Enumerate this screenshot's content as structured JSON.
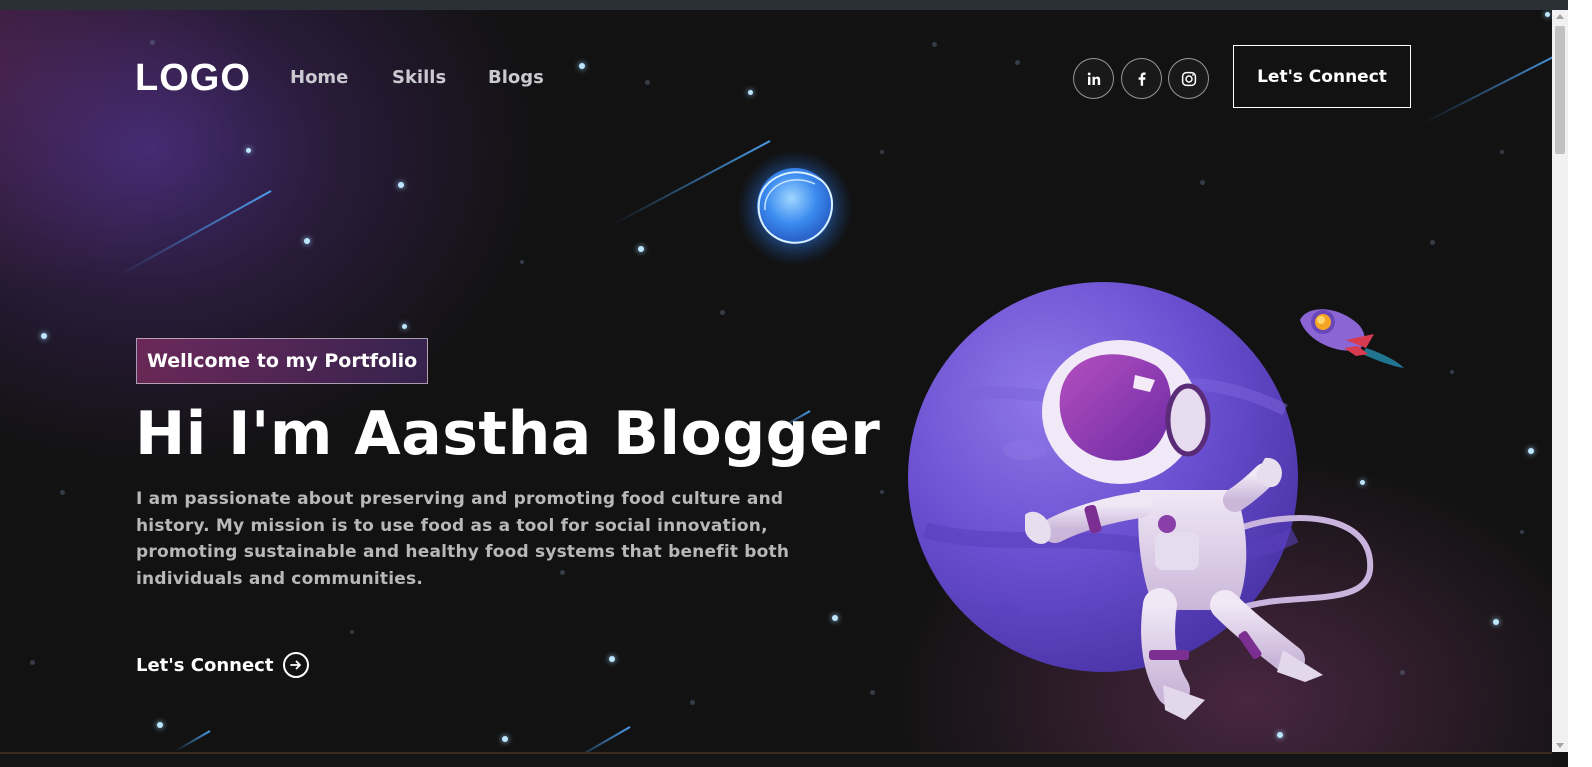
{
  "nav": {
    "logo": "LOGO",
    "links": [
      "Home",
      "Skills",
      "Blogs"
    ],
    "social": [
      "linkedin-icon",
      "facebook-icon",
      "instagram-icon"
    ],
    "connect_button": "Let's Connect"
  },
  "hero": {
    "tagline": "Wellcome to my Portfolio",
    "title": "Hi I'm Aastha Blogger",
    "description": "I am passionate about preserving and promoting food culture and history. My mission is to use food as a tool for social innovation, promoting sustainable and healthy food systems that benefit both individuals and communities.",
    "cta": "Let's Connect"
  },
  "colors": {
    "background": "#121212",
    "accent_purple": "#4a2f7d",
    "accent_pink": "#aa367c",
    "text_muted": "#b8b8b8"
  }
}
